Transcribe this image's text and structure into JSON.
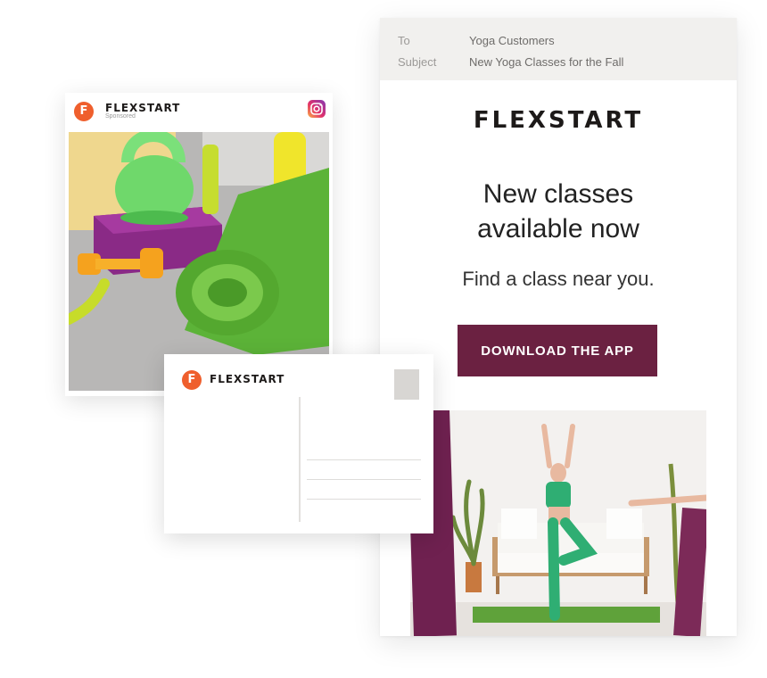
{
  "email": {
    "to_label": "To",
    "to_value": "Yoga Customers",
    "subject_label": "Subject",
    "subject_value": "New Yoga Classes for the Fall",
    "logo": "FLEXSTART",
    "headline_line1": "New classes",
    "headline_line2": "available now",
    "subheadline": "Find a class near you.",
    "cta_label": "DOWNLOAD THE APP",
    "accent_color": "#6b2141"
  },
  "instagram_ad": {
    "avatar_letter": "F",
    "brand": "FLEXSTART",
    "sponsored": "Sponsored",
    "icon": "instagram-icon",
    "brand_color": "#ef5f2d"
  },
  "postcard": {
    "avatar_letter": "F",
    "brand": "FLEXSTART"
  }
}
